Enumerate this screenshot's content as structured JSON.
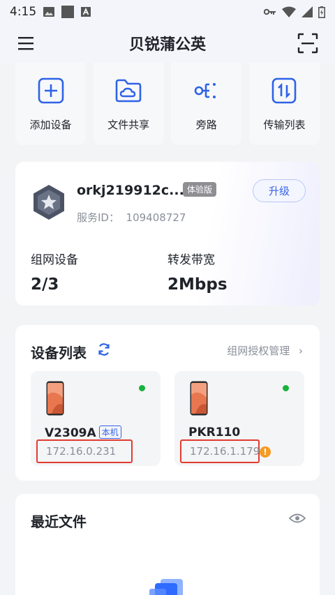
{
  "status_bar": {
    "time": "4:15",
    "left_icons": [
      "image-icon",
      "square-icon",
      "a-letter-icon"
    ],
    "right_icons": [
      "vpn-key-icon",
      "wifi-icon",
      "signal-icon",
      "battery-icon"
    ]
  },
  "header": {
    "title": "贝锐蒲公英",
    "menu_icon": "menu-icon",
    "scan_icon": "scan-icon"
  },
  "quick_actions": [
    {
      "label": "添加设备",
      "icon": "add-box-icon"
    },
    {
      "label": "文件共享",
      "icon": "cloud-folder-icon"
    },
    {
      "label": "旁路",
      "icon": "bypass-icon"
    },
    {
      "label": "传输列表",
      "icon": "transfer-icon"
    }
  ],
  "service": {
    "name": "orkj219912c...",
    "tag": "体验版",
    "upgrade_label": "升级",
    "id_label": "服务ID：",
    "id_value": "109408727",
    "stats": [
      {
        "label": "组网设备",
        "value": "2/3"
      },
      {
        "label": "转发带宽",
        "value": "2Mbps"
      }
    ]
  },
  "devices": {
    "title": "设备列表",
    "manage_label": "组网授权管理",
    "items": [
      {
        "name": "V2309A",
        "tag": "本机",
        "ip": "172.16.0.231",
        "online": true,
        "warning": false
      },
      {
        "name": "PKR110",
        "tag": "",
        "ip": "172.16.1.179",
        "online": true,
        "warning": true
      }
    ]
  },
  "recent_files": {
    "title": "最近文件"
  },
  "colors": {
    "accent": "#3563e9",
    "online": "#19b23b",
    "warning": "#f59a23",
    "highlight": "#e23b30"
  }
}
